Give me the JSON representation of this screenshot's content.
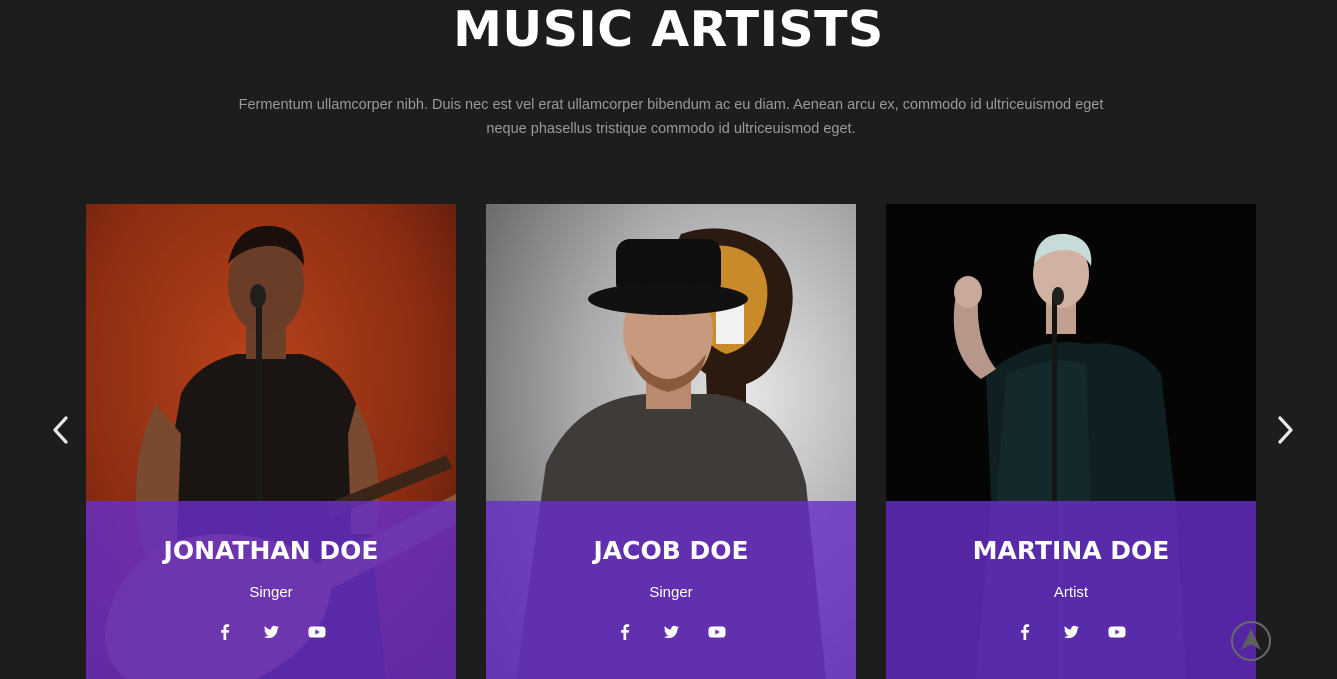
{
  "section": {
    "title": "MUSIC ARTISTS",
    "description": "Fermentum ullamcorper nibh. Duis nec est vel erat ullamcorper bibendum ac eu diam. Aenean arcu ex, commodo id ultriceuismod eget neque phasellus tristique commodo id ultriceuismod eget."
  },
  "artists": [
    {
      "name": "JONATHAN DOE",
      "role": "Singer"
    },
    {
      "name": "JACOB DOE",
      "role": "Singer"
    },
    {
      "name": "MARTINA DOE",
      "role": "Artist"
    }
  ],
  "social_icons": [
    "facebook-icon",
    "twitter-icon",
    "youtube-icon"
  ],
  "icons": {
    "prev": "chevron-left-icon",
    "next": "chevron-right-icon",
    "back_to_top": "arrow-up-icon"
  },
  "colors": {
    "background": "#1d1d1d",
    "card_overlay": "#682ec8",
    "title": "#ffffff",
    "subtitle": "#9a9a9a"
  }
}
